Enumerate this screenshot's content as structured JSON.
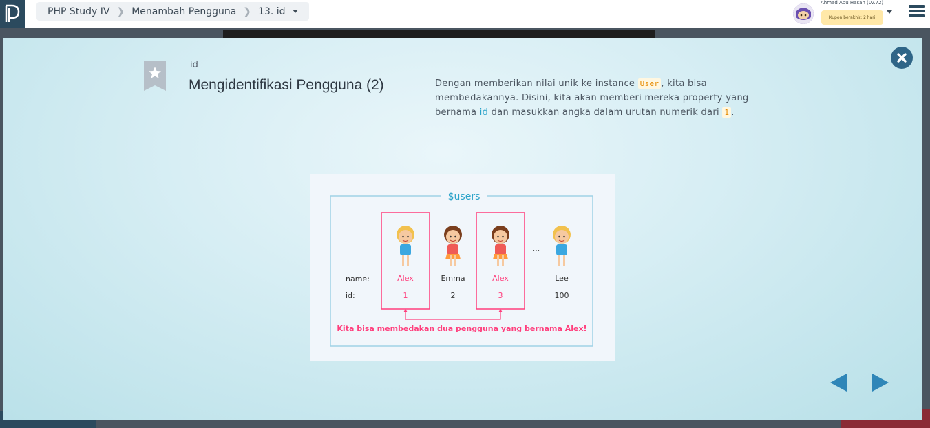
{
  "header": {
    "breadcrumb": [
      "PHP Study IV",
      "Menambah Pengguna",
      "13. id"
    ],
    "user_name": "Ahmad Abu Hasan (Lv.72)",
    "coupon": "Kupon berakhir: 2 hari"
  },
  "modal": {
    "lesson_id": "id",
    "title": "Mengidentifikasi Pengguna (2)",
    "desc": {
      "p1": "Dengan memberikan nilai unik ke instance ",
      "code1": "User",
      "p2": ", kita bisa membedakannya. Disini, kita akan memberi mereka property yang bernama ",
      "hl": "id",
      "p3": " dan masukkan angka dalam urutan numerik dari ",
      "code2": "1",
      "p4": "."
    }
  },
  "figure": {
    "caption_label": "$users",
    "row_name": "name:",
    "row_id": "id:",
    "ellipsis": "...",
    "users": [
      {
        "name": "Alex",
        "id": "1",
        "highlight": true,
        "gender": "boy"
      },
      {
        "name": "Emma",
        "id": "2",
        "highlight": false,
        "gender": "girl"
      },
      {
        "name": "Alex",
        "id": "3",
        "highlight": true,
        "gender": "girl"
      },
      {
        "name": "Lee",
        "id": "100",
        "highlight": false,
        "gender": "boy"
      }
    ],
    "footer": "Kita bisa membedakan dua pengguna yang bernama Alex!"
  },
  "colors": {
    "accent": "#2ba3c9",
    "pink": "#ff3f7d",
    "navy": "#2b4a5e"
  }
}
